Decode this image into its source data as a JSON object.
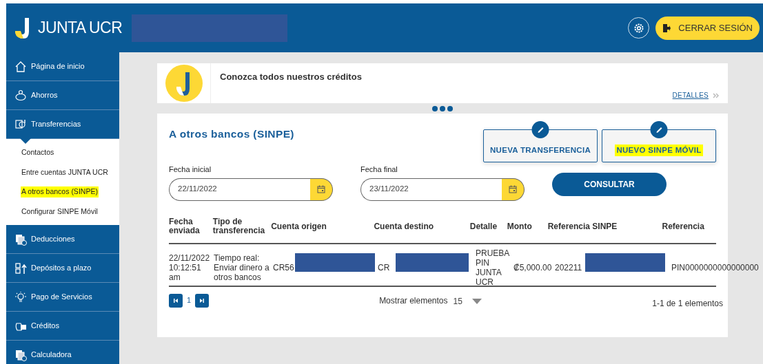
{
  "header": {
    "brand": "JUNTA UCR",
    "user_redacted": true,
    "logout": "CERRAR SESIÓN"
  },
  "sidebar": {
    "items": [
      {
        "label": "Página de inicio",
        "expanded": false
      },
      {
        "label": "Ahorros",
        "expanded": false
      },
      {
        "label": "Transferencias",
        "expanded": true,
        "children": [
          {
            "label": "Contactos",
            "highlighted": false
          },
          {
            "label": "Entre cuentas JUNTA UCR",
            "highlighted": false
          },
          {
            "label": "A otros bancos (SINPE)",
            "highlighted": true
          },
          {
            "label": "Configurar SINPE Móvil",
            "highlighted": false
          }
        ]
      },
      {
        "label": "Deducciones",
        "expanded": false
      },
      {
        "label": "Depósitos a plazo",
        "expanded": false
      },
      {
        "label": "Pago de Servicios",
        "expanded": false
      },
      {
        "label": "Créditos",
        "expanded": false
      },
      {
        "label": "Calculadora",
        "expanded": false
      }
    ]
  },
  "banner": {
    "title": "Conozca todos nuestros créditos",
    "link": "DETALLES",
    "slides": [
      {
        "selected": true
      },
      {
        "selected": true
      },
      {
        "selected": true
      }
    ]
  },
  "page": {
    "title": "A otros bancos (SINPE)",
    "actions": [
      {
        "label": "NUEVA TRANSFERENCIA",
        "highlighted": false
      },
      {
        "label": "NUEVO SINPE MÓVIL",
        "highlighted": true
      }
    ],
    "filters": [
      {
        "label": "Fecha inicial",
        "value": "22/11/2022"
      },
      {
        "label": "Fecha final",
        "value": "23/11/2022"
      }
    ],
    "submit": "CONSULTAR"
  },
  "table": {
    "columns": [
      "Fecha enviada",
      "Tipo de transferencia",
      "Cuenta origen",
      "Cuenta destino",
      "Detalle",
      "Monto",
      "Referencia SINPE",
      "Referencia"
    ],
    "rows": [
      {
        "cells": [
          {
            "text": "22/11/2022 10:12:51 am",
            "redacted": false
          },
          {
            "text": "Tiempo real: Enviar dinero a otros bancos",
            "redacted": false
          },
          {
            "text": "CR56",
            "redacted": true
          },
          {
            "text": "CR",
            "redacted": true
          },
          {
            "text": "PRUEBA PIN JUNTA UCR",
            "redacted": false
          },
          {
            "text": "₡5,000.00",
            "redacted": false
          },
          {
            "text": "202211",
            "redacted": true
          },
          {
            "text": "PIN0000000000000000",
            "redacted": false
          }
        ]
      }
    ]
  },
  "pagination": {
    "page": "1",
    "page_size_label": "Mostrar elementos",
    "page_size": "15",
    "summary": "1-1 de 1 elementos"
  }
}
